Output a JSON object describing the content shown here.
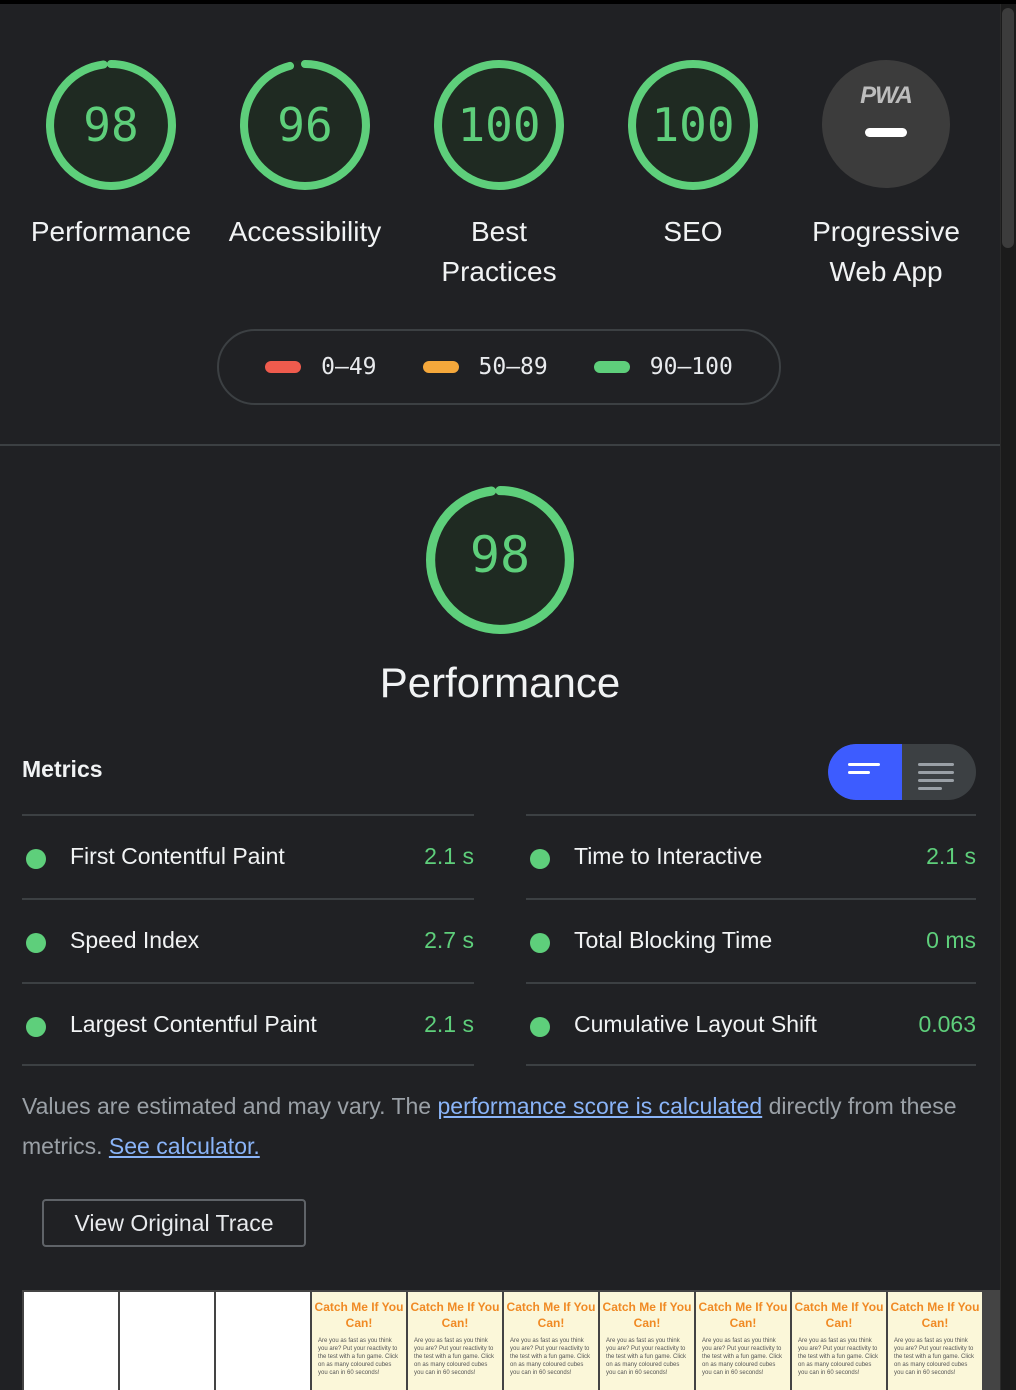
{
  "categories": [
    {
      "id": "performance",
      "score": "98",
      "score_fraction": 0.98,
      "label": "Performance"
    },
    {
      "id": "accessibility",
      "score": "96",
      "score_fraction": 0.96,
      "label": "Accessibility"
    },
    {
      "id": "best-practices",
      "score": "100",
      "score_fraction": 1.0,
      "label_line1": "Best",
      "label_line2": "Practices"
    },
    {
      "id": "seo",
      "score": "100",
      "score_fraction": 1.0,
      "label": "SEO"
    },
    {
      "id": "pwa",
      "badge": "PWA",
      "label_line1": "Progressive",
      "label_line2": "Web App"
    }
  ],
  "legend": [
    {
      "range": "0–49",
      "color": "#ef5b4d"
    },
    {
      "range": "50–89",
      "color": "#f5a83b"
    },
    {
      "range": "90–100",
      "color": "#5ecf7b"
    }
  ],
  "performance": {
    "score": "98",
    "score_fraction": 0.98,
    "title": "Performance",
    "metrics_label": "Metrics",
    "metrics": {
      "left": [
        {
          "name": "First Contentful Paint",
          "value": "2.1 s"
        },
        {
          "name": "Speed Index",
          "value": "2.7 s"
        },
        {
          "name": "Largest Contentful Paint",
          "value": "2.1 s"
        }
      ],
      "right": [
        {
          "name": "Time to Interactive",
          "value": "2.1 s"
        },
        {
          "name": "Total Blocking Time",
          "value": "0 ms"
        },
        {
          "name": "Cumulative Layout Shift",
          "value": "0.063"
        }
      ]
    },
    "note_prefix": "Values are estimated and may vary. The ",
    "note_link": "performance score is calculated",
    "note_suffix": " directly from these metrics. ",
    "calculator_link": "See calculator.",
    "trace_button": "View Original Trace"
  },
  "filmstrip": {
    "frame_title_1": "Catch Me If You",
    "frame_title_2": "Can!",
    "frame_text": "Are you as fast as you think you are? Put your reactivity to the test with a fun game. Click on as many coloured cubes you can in 60 seconds!"
  },
  "colors": {
    "pass": "#5ecf7b",
    "accent": "#3d5cff",
    "link": "#8ab4f8"
  }
}
